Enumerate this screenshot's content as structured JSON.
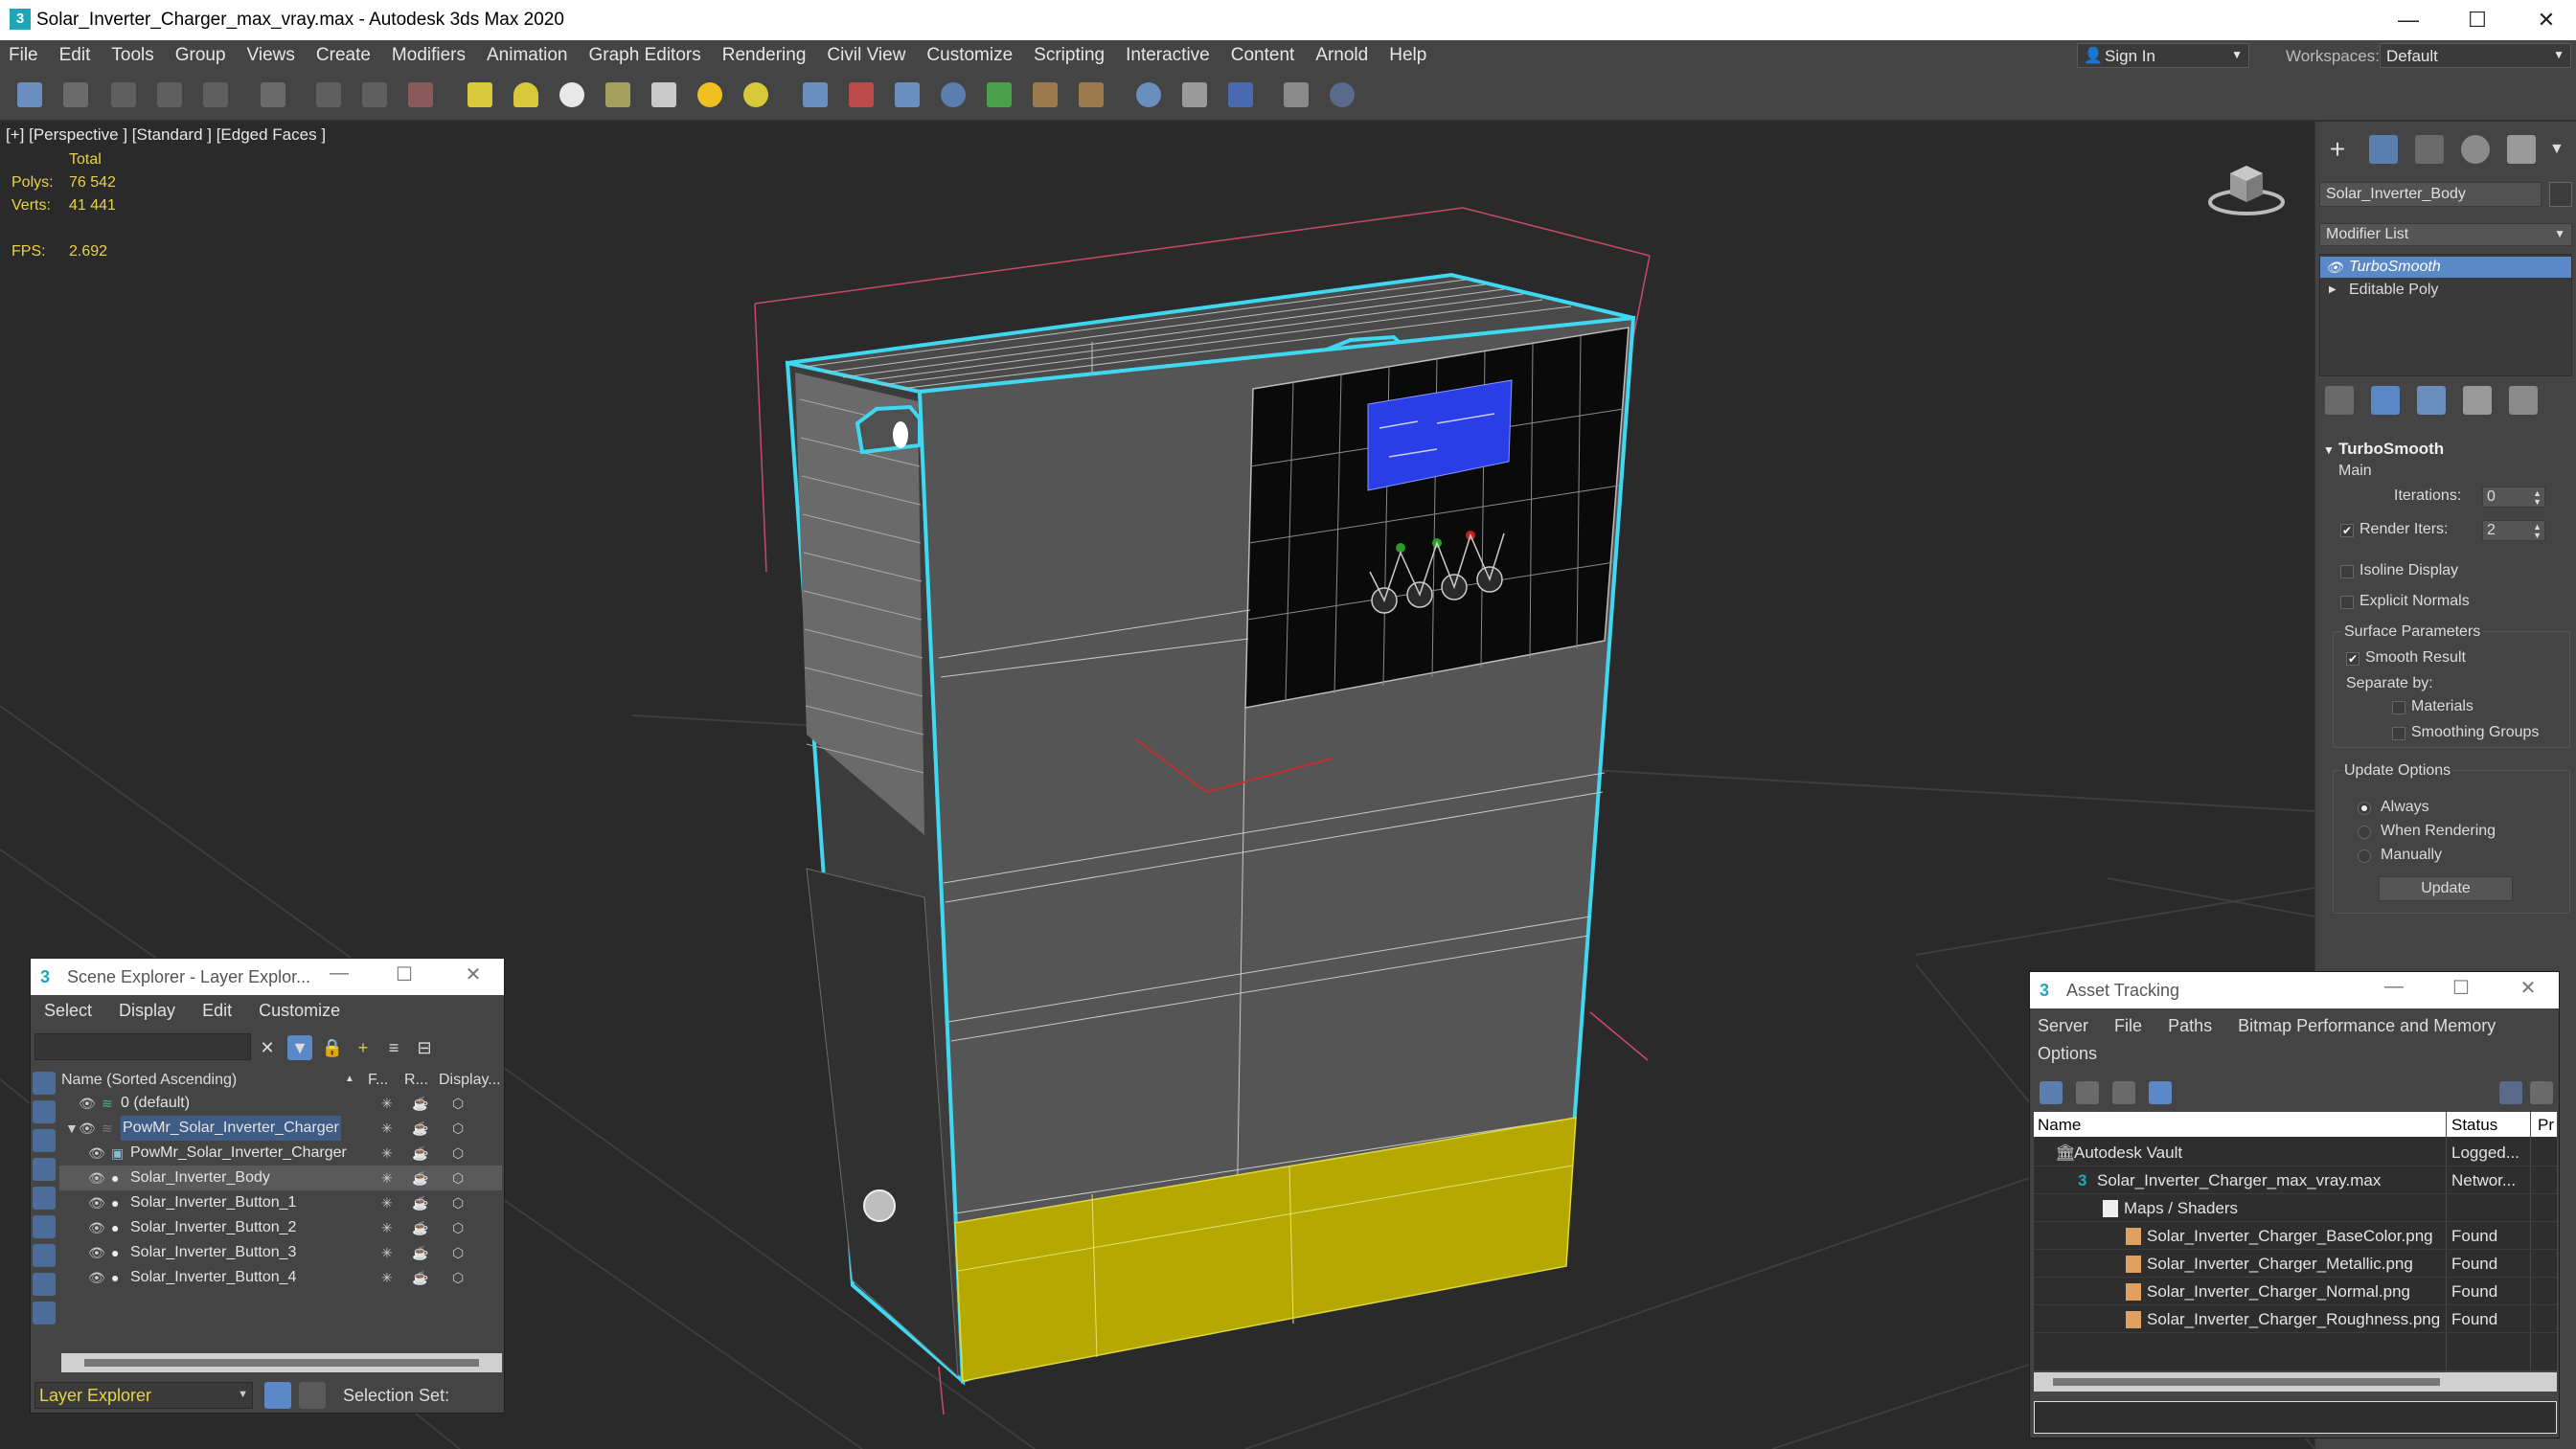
{
  "titlebar": {
    "title": "Solar_Inverter_Charger_max_vray.max - Autodesk 3ds Max 2020",
    "app_icon": "3",
    "minimize": "—",
    "maximize": "☐",
    "close": "✕"
  },
  "menubar": {
    "items": [
      "File",
      "Edit",
      "Tools",
      "Group",
      "Views",
      "Create",
      "Modifiers",
      "Animation",
      "Graph Editors",
      "Rendering",
      "Civil View",
      "Customize",
      "Scripting",
      "Interactive",
      "Content",
      "Arnold",
      "Help"
    ],
    "sign_in": "Sign In",
    "workspaces_label": "Workspaces:",
    "workspace": "Default"
  },
  "viewport": {
    "label": "[+] [Perspective ] [Standard ] [Edged Faces ]",
    "total_label": "Total",
    "polys_label": "Polys:",
    "polys": "76 542",
    "verts_label": "Verts:",
    "verts": "41 441",
    "fps_label": "FPS:",
    "fps": "2.692"
  },
  "command_panel": {
    "object_name": "Solar_Inverter_Body",
    "modifier_list": "Modifier List",
    "stack": [
      "TurboSmooth",
      "Editable Poly"
    ],
    "rollout_title": "TurboSmooth",
    "main_label": "Main",
    "iterations_label": "Iterations:",
    "iterations": "0",
    "render_iters_label": "Render Iters:",
    "render_iters": "2",
    "render_iters_checked": "✔",
    "isoline_label": "Isoline Display",
    "explicit_label": "Explicit Normals",
    "surface_label": "Surface Parameters",
    "smooth_result_label": "Smooth Result",
    "smooth_result_checked": "✔",
    "separate_by_label": "Separate by:",
    "materials_label": "Materials",
    "smoothing_groups_label": "Smoothing Groups",
    "update_options_label": "Update Options",
    "always_label": "Always",
    "when_rendering_label": "When Rendering",
    "manually_label": "Manually",
    "update_button": "Update"
  },
  "scene_explorer": {
    "title": "Scene Explorer - Layer Explor...",
    "menu": [
      "Select",
      "Display",
      "Edit",
      "Customize"
    ],
    "col_name": "Name (Sorted Ascending)",
    "col_sort": "▲",
    "col_f": "F...",
    "col_r": "R...",
    "col_display": "Display...",
    "rows": [
      {
        "name": "0 (default)"
      },
      {
        "name": "PowMr_Solar_Inverter_Charger"
      },
      {
        "name": "PowMr_Solar_Inverter_Charger"
      },
      {
        "name": "Solar_Inverter_Body"
      },
      {
        "name": "Solar_Inverter_Button_1"
      },
      {
        "name": "Solar_Inverter_Button_2"
      },
      {
        "name": "Solar_Inverter_Button_3"
      },
      {
        "name": "Solar_Inverter_Button_4"
      }
    ],
    "layer_select": "Layer Explorer",
    "selection_set": "Selection Set:"
  },
  "asset_tracking": {
    "title": "Asset Tracking",
    "menu": [
      "Server",
      "File",
      "Paths",
      "Bitmap Performance and Memory"
    ],
    "menu_options": "Options",
    "col_name": "Name",
    "col_status": "Status",
    "col_pr": "Pr",
    "rows": [
      {
        "name": "Autodesk Vault",
        "status": "Logged..."
      },
      {
        "name": "Solar_Inverter_Charger_max_vray.max",
        "status": "Networ..."
      },
      {
        "name": "Maps / Shaders",
        "status": ""
      },
      {
        "name": "Solar_Inverter_Charger_BaseColor.png",
        "status": "Found"
      },
      {
        "name": "Solar_Inverter_Charger_Metallic.png",
        "status": "Found"
      },
      {
        "name": "Solar_Inverter_Charger_Normal.png",
        "status": "Found"
      },
      {
        "name": "Solar_Inverter_Charger_Roughness.png",
        "status": "Found"
      }
    ]
  },
  "colors": {
    "ui_bg": "#444444",
    "viewport_bg": "#2a2a2a",
    "selection_outline": "#40d8f0",
    "stat_text": "#e8d24a",
    "highlight_blue": "#5b88c7",
    "battery_yellow": "#c8b800",
    "lcd_blue": "#2040e0"
  }
}
